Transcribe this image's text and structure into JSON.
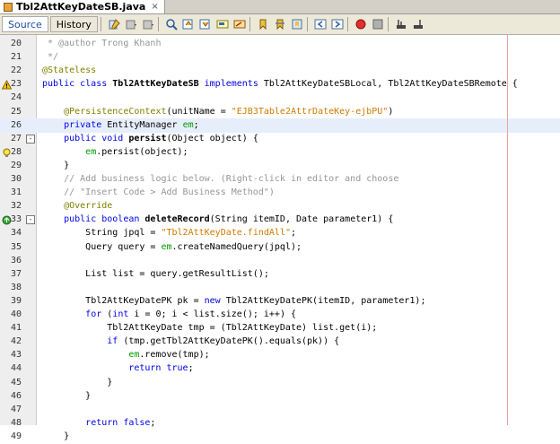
{
  "tab": {
    "filename": "Tbl2AttKeyDateSB.java",
    "close": "×"
  },
  "toolbar": {
    "source_label": "Source",
    "history_label": "History"
  },
  "editor": {
    "current_line": 26,
    "lines": [
      {
        "n": "20",
        "segs": [
          [
            "com",
            "* @author Trong Khanh"
          ]
        ],
        "indent": 1
      },
      {
        "n": "21",
        "segs": [
          [
            "com",
            "*/"
          ]
        ],
        "indent": 1
      },
      {
        "n": "22",
        "segs": [
          [
            "ann",
            "@Stateless"
          ]
        ],
        "indent": 0
      },
      {
        "n": "23",
        "icon": "warning",
        "segs": [
          [
            "kw",
            "public class "
          ],
          [
            "bold",
            "Tbl2AttKeyDateSB"
          ],
          [
            "kw",
            " implements "
          ],
          [
            "",
            "Tbl2AttKeyDateSBLocal, Tbl2AttKeyDateSBRemote {"
          ]
        ],
        "indent": 0
      },
      {
        "n": "24",
        "segs": [],
        "indent": 0
      },
      {
        "n": "25",
        "segs": [
          [
            "ann",
            "@PersistenceContext"
          ],
          [
            "",
            "(unitName = "
          ],
          [
            "str",
            "\"EJB3Table2AttrDateKey-ejbPU\""
          ],
          [
            "",
            ")"
          ]
        ],
        "indent": 4
      },
      {
        "n": "26",
        "segs": [
          [
            "kw",
            "private "
          ],
          [
            "",
            "EntityManager "
          ],
          [
            "fld",
            "em"
          ],
          [
            "",
            ";"
          ]
        ],
        "indent": 4
      },
      {
        "n": "27",
        "fold": "-",
        "segs": [
          [
            "kw",
            "public void "
          ],
          [
            "bold",
            "persist"
          ],
          [
            "",
            "(Object object) {"
          ]
        ],
        "indent": 4
      },
      {
        "n": "28",
        "icon": "bulb",
        "segs": [
          [
            "fld",
            "em"
          ],
          [
            "",
            ".persist(object);"
          ]
        ],
        "indent": 8
      },
      {
        "n": "29",
        "segs": [
          [
            "",
            "}"
          ]
        ],
        "indent": 4
      },
      {
        "n": "30",
        "segs": [
          [
            "com",
            "// Add business logic below. (Right-click in editor and choose"
          ]
        ],
        "indent": 4
      },
      {
        "n": "31",
        "segs": [
          [
            "com",
            "// \"Insert Code > Add Business Method\")"
          ]
        ],
        "indent": 4
      },
      {
        "n": "32",
        "segs": [
          [
            "ann",
            "@Override"
          ]
        ],
        "indent": 4
      },
      {
        "n": "33",
        "icon": "override",
        "fold": "-",
        "segs": [
          [
            "kw",
            "public boolean "
          ],
          [
            "bold",
            "deleteRecord"
          ],
          [
            "",
            "(String itemID, Date parameter1) {"
          ]
        ],
        "indent": 4
      },
      {
        "n": "34",
        "segs": [
          [
            "",
            "String jpql = "
          ],
          [
            "str",
            "\"Tbl2AttKeyDate.findAll\""
          ],
          [
            "",
            ";"
          ]
        ],
        "indent": 8
      },
      {
        "n": "35",
        "segs": [
          [
            "",
            "Query query = "
          ],
          [
            "fld",
            "em"
          ],
          [
            "",
            ".createNamedQuery(jpql);"
          ]
        ],
        "indent": 8
      },
      {
        "n": "36",
        "segs": [],
        "indent": 0
      },
      {
        "n": "37",
        "segs": [
          [
            "",
            "List list = query.getResultList();"
          ]
        ],
        "indent": 8
      },
      {
        "n": "38",
        "segs": [],
        "indent": 0
      },
      {
        "n": "39",
        "segs": [
          [
            "",
            "Tbl2AttKeyDatePK pk = "
          ],
          [
            "kw",
            "new "
          ],
          [
            "",
            "Tbl2AttKeyDatePK(itemID, parameter1);"
          ]
        ],
        "indent": 8
      },
      {
        "n": "40",
        "segs": [
          [
            "kw",
            "for "
          ],
          [
            "",
            "("
          ],
          [
            "kw",
            "int "
          ],
          [
            "",
            "i = 0; i < list.size(); i++) {"
          ]
        ],
        "indent": 8
      },
      {
        "n": "41",
        "segs": [
          [
            "",
            "Tbl2AttKeyDate tmp = (Tbl2AttKeyDate) list.get(i);"
          ]
        ],
        "indent": 12
      },
      {
        "n": "42",
        "segs": [
          [
            "kw",
            "if "
          ],
          [
            "",
            "(tmp.getTbl2AttKeyDatePK().equals(pk)) {"
          ]
        ],
        "indent": 12
      },
      {
        "n": "43",
        "segs": [
          [
            "fld",
            "em"
          ],
          [
            "",
            ".remove(tmp);"
          ]
        ],
        "indent": 16
      },
      {
        "n": "44",
        "segs": [
          [
            "kw",
            "return true"
          ],
          [
            "",
            ";"
          ]
        ],
        "indent": 16
      },
      {
        "n": "45",
        "segs": [
          [
            "",
            "}"
          ]
        ],
        "indent": 12
      },
      {
        "n": "46",
        "segs": [
          [
            "",
            "}"
          ]
        ],
        "indent": 8
      },
      {
        "n": "47",
        "segs": [],
        "indent": 0
      },
      {
        "n": "48",
        "segs": [
          [
            "kw",
            "return false"
          ],
          [
            "",
            ";"
          ]
        ],
        "indent": 8
      },
      {
        "n": "49",
        "segs": [
          [
            "",
            "}"
          ]
        ],
        "indent": 4
      }
    ]
  },
  "colors": {
    "keyword": "#0000e6",
    "string": "#ce7b00",
    "comment": "#969696",
    "annotation": "#808000",
    "field": "#009900"
  }
}
